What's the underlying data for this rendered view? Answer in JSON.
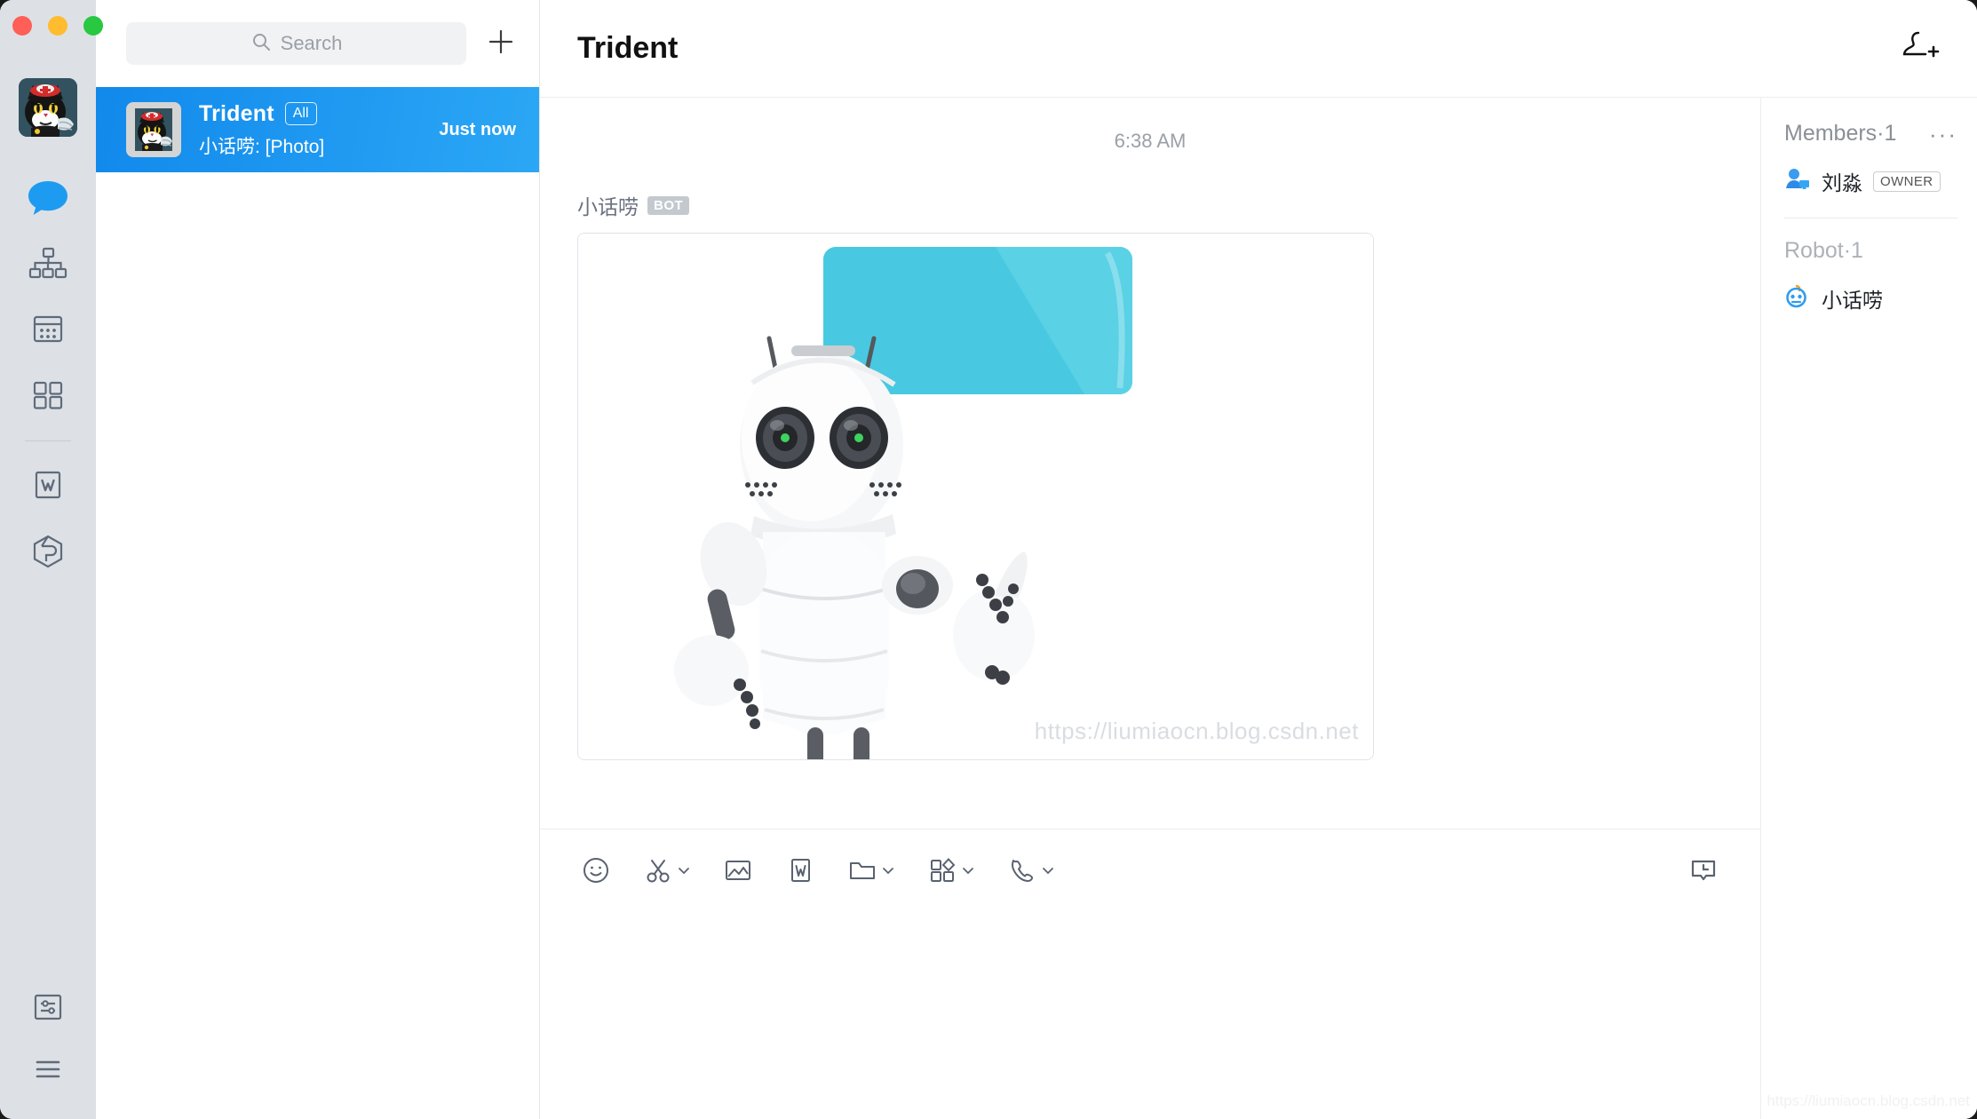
{
  "window": {
    "controls": [
      "close",
      "minimize",
      "maximize"
    ]
  },
  "rail": {
    "avatar_name": "user-avatar-cat",
    "items": [
      {
        "icon": "chat-bubble-icon",
        "name": "rail-item-messages",
        "active": true
      },
      {
        "icon": "org-chart-icon",
        "name": "rail-item-contacts",
        "active": false
      },
      {
        "icon": "calendar-icon",
        "name": "rail-item-calendar",
        "active": false
      },
      {
        "icon": "grid-icon",
        "name": "rail-item-workspace",
        "active": false
      },
      {
        "icon": "w-document-icon",
        "name": "rail-item-docs",
        "active": false
      },
      {
        "icon": "hexagon-cube-icon",
        "name": "rail-item-apps",
        "active": false
      }
    ],
    "bottom_items": [
      {
        "icon": "settings-sliders-icon",
        "name": "rail-item-settings"
      },
      {
        "icon": "hamburger-menu-icon",
        "name": "rail-item-more"
      }
    ]
  },
  "search": {
    "placeholder": "Search",
    "value": ""
  },
  "list": {
    "add_label": "+",
    "chats": [
      {
        "title": "Trident",
        "tag": "All",
        "preview": "小话唠: [Photo]",
        "time": "Just now",
        "selected": true
      }
    ]
  },
  "header": {
    "title": "Trident",
    "add_member_icon": "add-person-icon"
  },
  "conversation": {
    "timestamp": "6:38 AM",
    "messages": [
      {
        "sender": "小话唠",
        "badge": "BOT",
        "type": "photo",
        "watermark": "https://liumiaocn.blog.csdn.net"
      }
    ]
  },
  "toolbar": {
    "items": [
      {
        "icon": "emoji-icon",
        "name": "emoji-button",
        "caret": false
      },
      {
        "icon": "scissors-screenshot-icon",
        "name": "screenshot-button",
        "caret": true
      },
      {
        "icon": "image-icon",
        "name": "image-button",
        "caret": false
      },
      {
        "icon": "w-document-icon",
        "name": "document-button",
        "caret": false
      },
      {
        "icon": "folder-icon",
        "name": "file-button",
        "caret": true
      },
      {
        "icon": "apps-grid-icon",
        "name": "apps-button",
        "caret": true
      },
      {
        "icon": "phone-icon",
        "name": "call-button",
        "caret": true
      }
    ],
    "history_icon": "chat-history-icon"
  },
  "members": {
    "title": "Members·1",
    "more": "···",
    "people": [
      {
        "name": "刘淼",
        "badge": "OWNER",
        "icon": "person-desktop-icon"
      }
    ],
    "robot_group": "Robot·1",
    "robots": [
      {
        "name": "小话唠",
        "icon": "robot-icon"
      }
    ]
  },
  "watermark": {
    "corner": "https://liumiaocn.blog.csdn.net"
  },
  "colors": {
    "accent": "#1d9bf0",
    "selected_row_start": "#1189ec",
    "selected_row_end": "#2ba7f5",
    "rail_bg": "#dde1e6",
    "icon_gray": "#5f6b7a",
    "bot_badge": "#c4c9cf",
    "speech_bubble": "#4fc9e0"
  }
}
